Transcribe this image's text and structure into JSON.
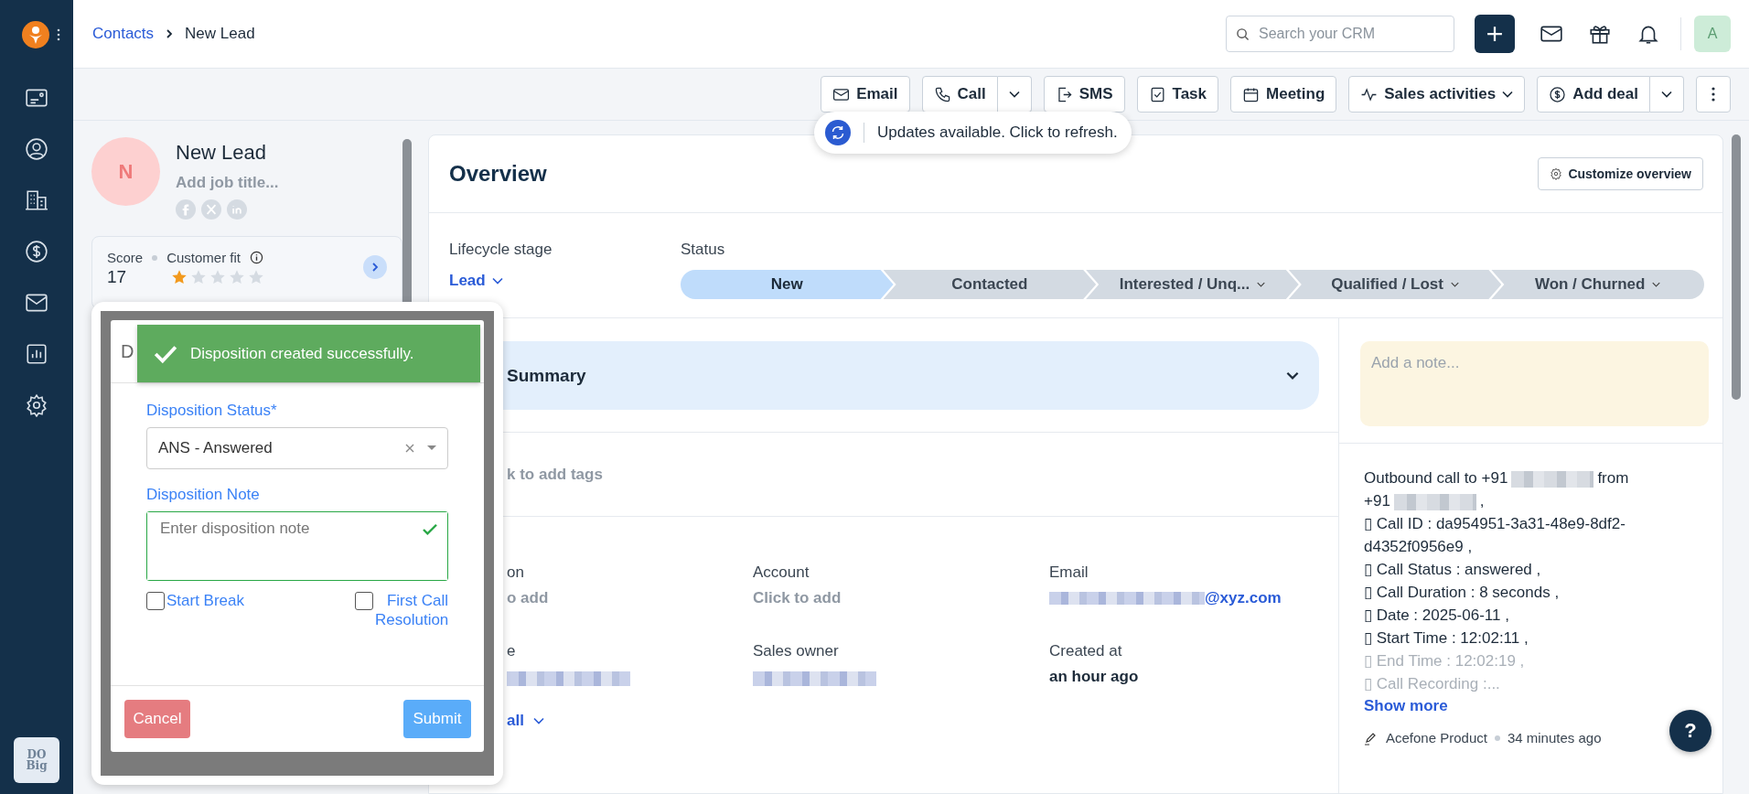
{
  "sidebar": {
    "footer_logo": [
      "DO",
      "Big"
    ]
  },
  "breadcrumb": [
    "Contacts",
    "New Lead"
  ],
  "search": {
    "placeholder": "Search your CRM"
  },
  "user": {
    "initial": "A"
  },
  "toolbar": [
    {
      "kind": "email",
      "label": "Email",
      "menu": false
    },
    {
      "kind": "call",
      "label": "Call",
      "menu": true,
      "split": true
    },
    {
      "kind": "sms",
      "label": "SMS",
      "menu": false
    },
    {
      "kind": "task",
      "label": "Task",
      "menu": false
    },
    {
      "kind": "meeting",
      "label": "Meeting",
      "menu": false
    },
    {
      "kind": "activities",
      "label": "Sales activities",
      "menu": true,
      "split": false
    },
    {
      "kind": "deal",
      "label": "Add deal",
      "menu": true,
      "split": true
    },
    {
      "kind": "more"
    }
  ],
  "notice": "Updates available. Click to refresh.",
  "profile": {
    "initial": "N",
    "name": "New Lead",
    "job_placeholder": "Add job title...",
    "score_label": "Score",
    "score": "17",
    "fit_label": "Customer fit",
    "stars": 1
  },
  "overview": {
    "title": "Overview",
    "customize": "Customize overview",
    "lifecycle_label": "Lifecycle stage",
    "lifecycle": "Lead",
    "status_label": "Status",
    "stages": [
      {
        "label": "New",
        "selected": true,
        "menu": false
      },
      {
        "label": "Contacted",
        "selected": false,
        "menu": false
      },
      {
        "label": "Interested / Unq...",
        "selected": false,
        "menu": true
      },
      {
        "label": "Qualified / Lost",
        "selected": false,
        "menu": true
      },
      {
        "label": "Won / Churned",
        "selected": false,
        "menu": true
      }
    ]
  },
  "summary": {
    "title": "Summary"
  },
  "tags": "k to add tags",
  "fields": [
    {
      "label": "on",
      "placeholder": "o add",
      "kind": "placeholder"
    },
    {
      "label": "Account",
      "placeholder": "Click to add",
      "kind": "placeholder"
    },
    {
      "label": "Email",
      "value": "@xyz.com",
      "kind": "link"
    },
    {
      "label": "e",
      "kind": "blurred"
    },
    {
      "label": "Sales owner",
      "kind": "blurred"
    },
    {
      "label": "Created at",
      "value": "an hour ago",
      "kind": "bold"
    }
  ],
  "view_all": "all",
  "note": {
    "placeholder": "Add a note..."
  },
  "activity": {
    "lines": [
      {
        "faded": false,
        "parts": [
          {
            "kind": "text",
            "text": "Outbound call to +91"
          },
          {
            "kind": "blur"
          },
          {
            "kind": "text",
            "text": "from"
          }
        ]
      },
      {
        "faded": false,
        "parts": [
          {
            "kind": "text",
            "text": "+91"
          },
          {
            "kind": "blur"
          },
          {
            "kind": "text",
            "text": ","
          }
        ]
      },
      {
        "faded": false,
        "parts": [
          {
            "kind": "text",
            "text": "▯ Call ID : da954951-3a31-48e9-8df2-d4352f0956e9 ,"
          }
        ]
      },
      {
        "faded": false,
        "parts": [
          {
            "kind": "text",
            "text": "▯ Call Status : answered ,"
          }
        ]
      },
      {
        "faded": false,
        "parts": [
          {
            "kind": "text",
            "text": "▯ Call Duration : 8 seconds ,"
          }
        ]
      },
      {
        "faded": false,
        "parts": [
          {
            "kind": "text",
            "text": "▯ Date : 2025-06-11 ,"
          }
        ]
      },
      {
        "faded": false,
        "parts": [
          {
            "kind": "text",
            "text": "▯ Start Time : 12:02:11 ,"
          }
        ]
      },
      {
        "faded": true,
        "parts": [
          {
            "kind": "text",
            "text": "▯ End Time : 12:02:19 ,"
          }
        ]
      },
      {
        "faded": true,
        "parts": [
          {
            "kind": "text",
            "text": "▯ Call Recording :..."
          }
        ]
      }
    ],
    "show_more": "Show more",
    "author": "Acefone Product",
    "time": "34 minutes ago"
  },
  "dialog": {
    "title": "D",
    "toast": "Disposition created successfully.",
    "status_label": "Disposition Status*",
    "status_value": "ANS - Answered",
    "note_label": "Disposition Note",
    "note_placeholder": "Enter disposition note",
    "note_valid": true,
    "options": [
      {
        "label": "Start Break",
        "checked": false
      },
      {
        "label": "First Call Resolution",
        "checked": false
      }
    ],
    "cancel": "Cancel",
    "submit": "Submit"
  },
  "help": "?"
}
